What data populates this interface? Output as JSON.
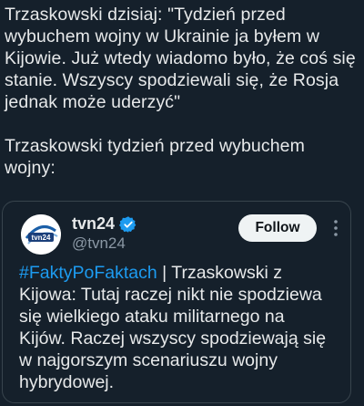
{
  "tweet": {
    "text": "Trzaskowski dzisiaj: \"Tydzień przed wybuchem wojny w Ukrainie ja byłem w Kijowie. Już wtedy wiadomo było, że coś się stanie. Wszyscy spodziewali się, że Rosja jednak może uderzyć\"\n\nTrzaskowski tydzień przed wybuchem wojny:"
  },
  "quote": {
    "display_name": "tvn24",
    "handle": "@tvn24",
    "follow_label": "Follow",
    "hashtag": "#FaktyPoFaktach",
    "body": " | Trzaskowski z Kijowa: Tutaj raczej nikt nie spodziewa się wielkiego ataku militarnego na Kijów. Raczej wszyscy spodziewają się w najgorszym scenariuszu wojny hybrydowej.",
    "avatar_text": "tvn24",
    "verified_icon": "verified-badge-icon",
    "more_icon": "more-options-icon"
  },
  "colors": {
    "background": "#15202b",
    "text": "#e7e9ea",
    "secondary_text": "#8b98a5",
    "accent": "#1d9bf0",
    "border": "#38444d",
    "follow_bg": "#eff3f4"
  }
}
